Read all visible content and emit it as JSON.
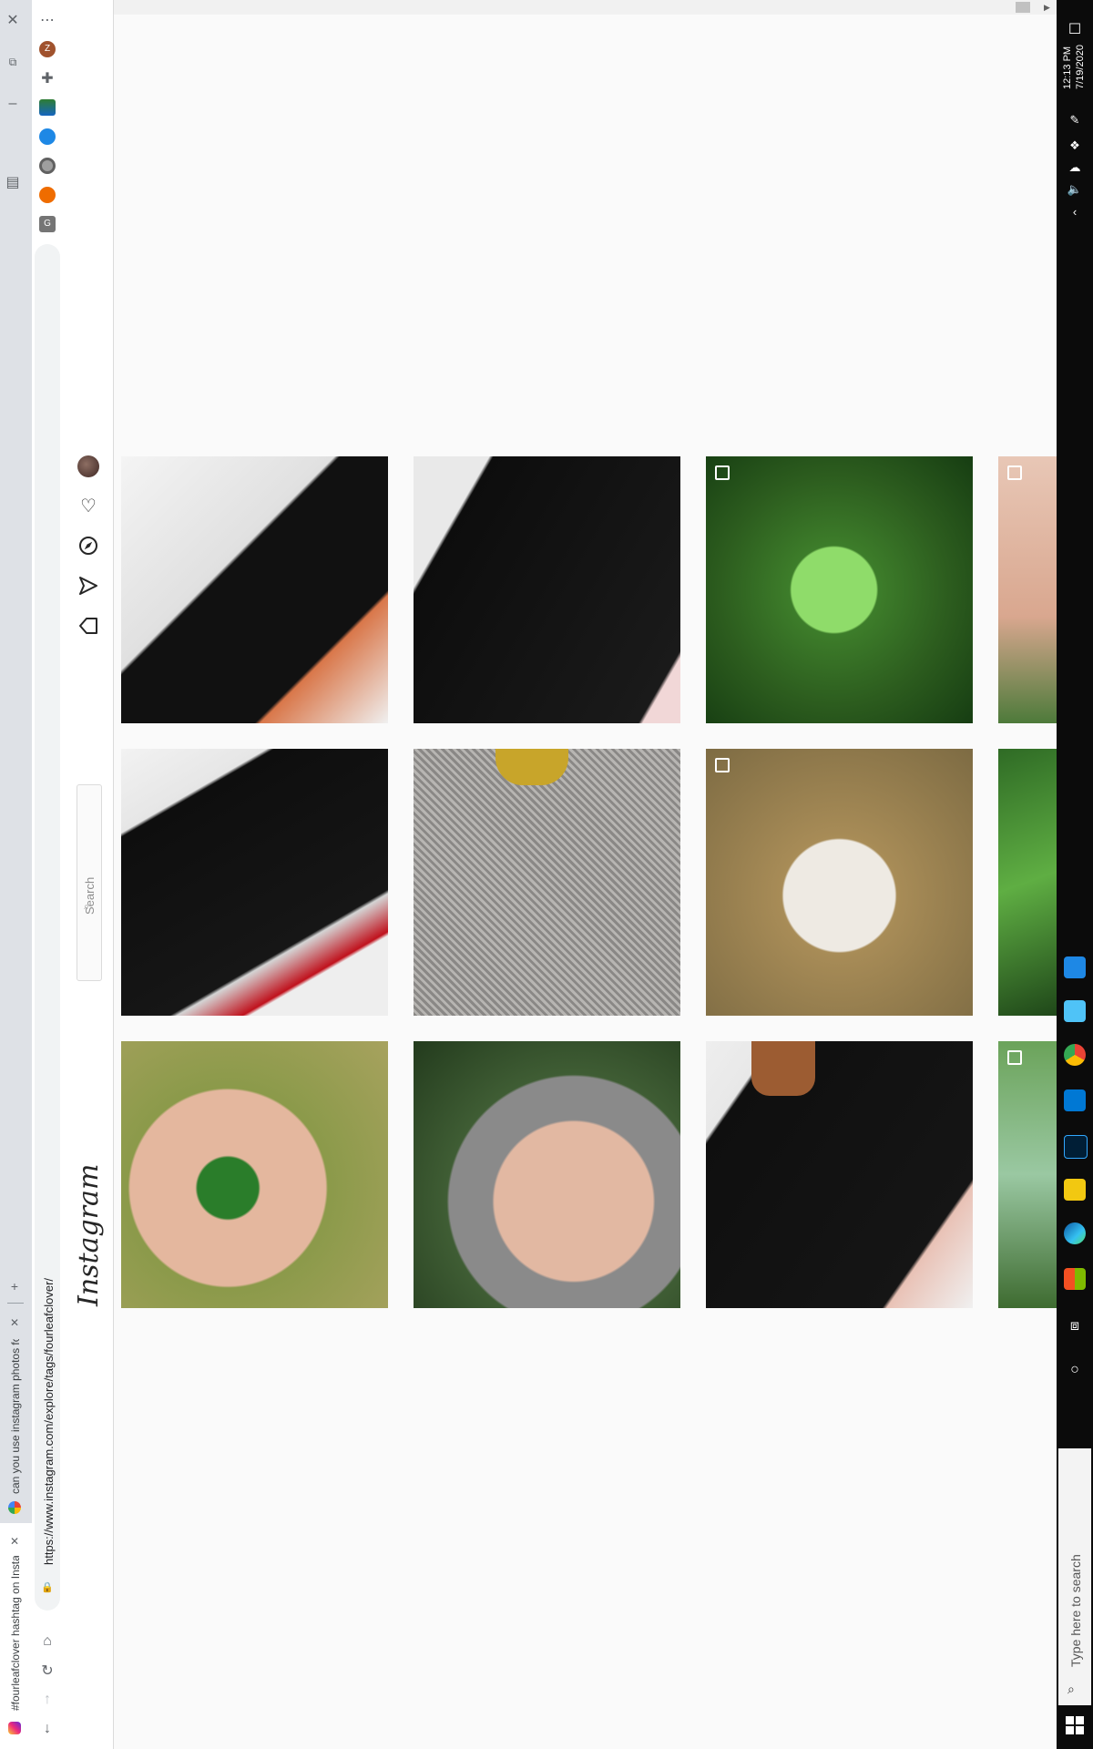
{
  "browser": {
    "tabs": [
      {
        "title": "#fourleafclover hashtag on Insta",
        "active": true
      },
      {
        "title": "can you use instagram photos fo",
        "active": false
      }
    ],
    "url": "https://www.instagram.com/explore/tags/fourleafclover/",
    "new_tab_label": "+",
    "menu_label": "⋯",
    "extension_badge": "Z",
    "extension_badge_2": "G"
  },
  "instagram": {
    "logo_text": "Instagram",
    "search_placeholder": "Search",
    "nav_icons": [
      "home-icon",
      "direct-icon",
      "explore-icon",
      "activity-icon",
      "profile-icon"
    ],
    "grid": [
      [
        {
          "subject": "black dress with tan sandals and orange clutch",
          "multi": false
        },
        {
          "subject": "black dress close-up",
          "multi": false
        },
        {
          "subject": "four-leaf clover in grass",
          "multi": true
        },
        {
          "subject": "clover held in fingers",
          "multi": true
        }
      ],
      [
        {
          "subject": "black dress with red heels",
          "multi": false
        },
        {
          "subject": "grey tweed skirt with yellow boots",
          "multi": false
        },
        {
          "subject": "goslings in straw",
          "multi": true
        },
        {
          "subject": "clover patch",
          "multi": false
        }
      ],
      [
        {
          "subject": "hand holding four-leaf clover",
          "multi": false
        },
        {
          "subject": "palm full of four-leaf clovers",
          "multi": false
        },
        {
          "subject": "black dress with brown sandals",
          "multi": false
        },
        {
          "subject": "clover leaves",
          "multi": true
        }
      ]
    ]
  },
  "taskbar": {
    "search_placeholder": "Type here to search",
    "time": "12:13 PM",
    "date": "7/19/2020"
  },
  "colors": {
    "taskbar_bg": "#0b0b0b",
    "ig_bg": "#fafafa",
    "tabstrip_bg": "#dee1e6",
    "ig_accent": "#262626"
  }
}
